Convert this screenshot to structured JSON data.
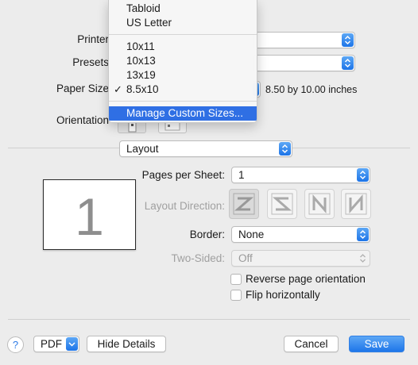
{
  "form": {
    "printer_label": "Printer",
    "presets_label": "Presets",
    "paper_size_label": "Paper Size",
    "paper_size_dimensions": "8.50 by 10.00 inches",
    "orientation_label": "Orientation"
  },
  "paper_menu": {
    "items_top": [
      "Tabloid",
      "US Letter"
    ],
    "items_custom": [
      "10x11",
      "10x13",
      "13x19",
      "8.5x10"
    ],
    "checked_item": "8.5x10",
    "checkmark": "✓",
    "manage_label": "Manage Custom Sizes..."
  },
  "section_select": {
    "value": "Layout"
  },
  "layout": {
    "preview_page_number": "1",
    "pages_per_sheet_label": "Pages per Sheet:",
    "pages_per_sheet_value": "1",
    "layout_direction_label": "Layout Direction:",
    "border_label": "Border:",
    "border_value": "None",
    "two_sided_label": "Two-Sided:",
    "two_sided_value": "Off",
    "reverse_orientation_label": "Reverse page orientation",
    "flip_horizontally_label": "Flip horizontally"
  },
  "footer": {
    "help_label": "?",
    "pdf_label": "PDF",
    "hide_details_label": "Hide Details",
    "cancel_label": "Cancel",
    "save_label": "Save"
  },
  "colors": {
    "accent": "#1e76e9",
    "menu_highlight": "#2f6fe4",
    "window_bg": "#ececec"
  }
}
